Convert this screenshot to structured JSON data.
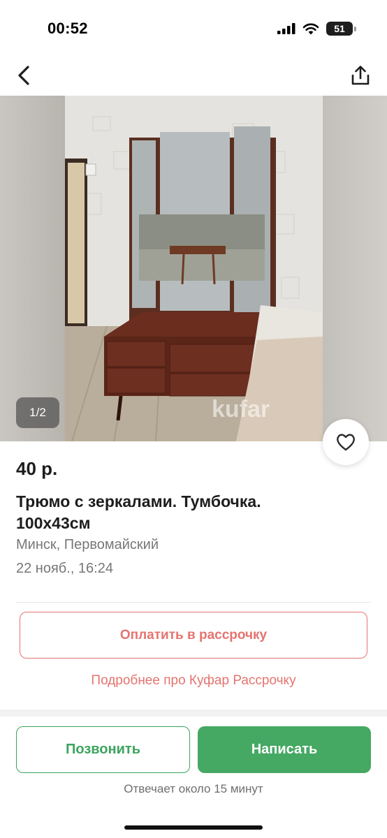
{
  "status_bar": {
    "time": "00:52",
    "battery": "51",
    "icons": [
      "signal-icon",
      "wifi-icon",
      "battery-icon"
    ]
  },
  "nav": {
    "icons": [
      "back-chevron-icon",
      "share-icon"
    ]
  },
  "gallery": {
    "counter": "1/2",
    "watermark": "kufar",
    "favorite_icon": "heart-icon"
  },
  "listing": {
    "price": "40 р.",
    "title": "Трюмо с зеркалами. Тумбочка. 100х43см",
    "location": "Минск, Первомайский",
    "date": "22 нояб., 16:24"
  },
  "installment": {
    "button_label": "Оплатить в рассрочку",
    "link_label": "Подробнее про Куфар Рассрочку"
  },
  "actions": {
    "call_label": "Позвонить",
    "write_label": "Написать",
    "reply_note": "Отвечает около 15 минут"
  },
  "colors": {
    "accent_red": "#e4746f",
    "accent_green": "#45a863",
    "text_primary": "#1d1d1d",
    "text_secondary": "#777777"
  }
}
